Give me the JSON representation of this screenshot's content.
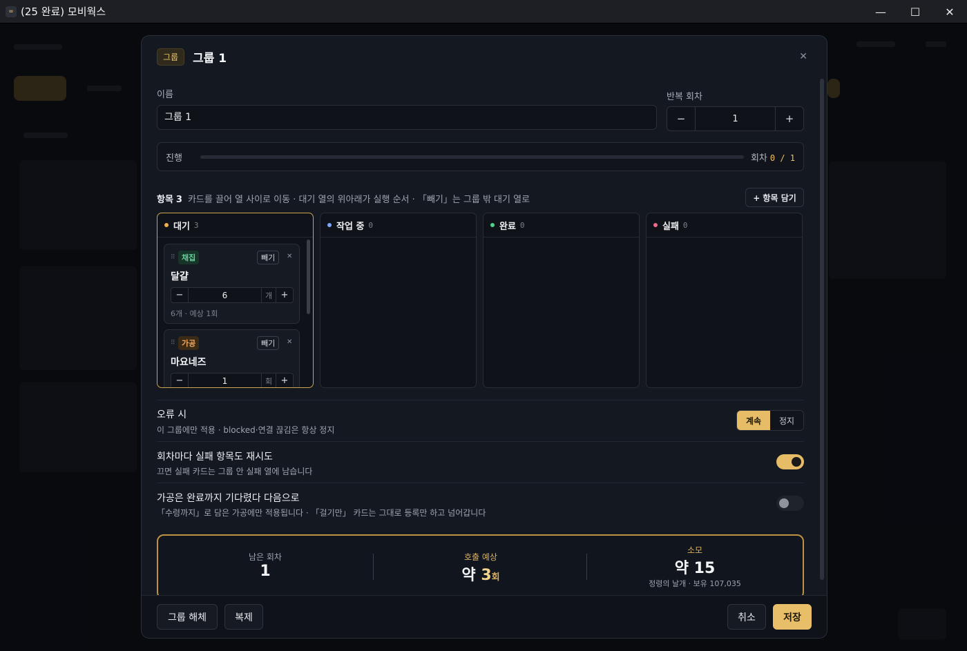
{
  "window": {
    "title": "(25 완료) 모비웍스"
  },
  "modal": {
    "chip": "그룹",
    "title": "그룹 1",
    "name_label": "이름",
    "name_value": "그룹 1",
    "repeat_label": "반복 회차",
    "repeat_value": "1",
    "progress": {
      "label": "진행",
      "round_label": "회차",
      "current": 0,
      "total": 1,
      "count_text": "0 / 1"
    },
    "items": {
      "title": "항목",
      "count": "3",
      "description": "카드를 끌어 열 사이로 이동 · 대기 열의 위아래가 실행 순서 · 「빼기」는 그룹 밖 대기 열로",
      "add_button": "+ 항목 담기"
    },
    "columns": [
      {
        "title": "대기",
        "count": "3",
        "color": "#f0b04a"
      },
      {
        "title": "작업 중",
        "count": "0",
        "color": "#7ea6ff"
      },
      {
        "title": "완료",
        "count": "0",
        "color": "#4fd38b"
      },
      {
        "title": "실패",
        "count": "0",
        "color": "#f06b8a"
      }
    ],
    "cards": [
      {
        "tag": "채집",
        "skip": "빼기",
        "name": "달걀",
        "qty": "6",
        "unit": "개",
        "meta": "6개 · 예상 1회"
      },
      {
        "tag": "가공",
        "skip": "빼기",
        "name": "마요네즈",
        "qty": "1",
        "unit": "회"
      }
    ],
    "on_error": {
      "title": "오류 시",
      "desc": "이 그룹에만 적용 · blocked·연결 끊김은 항상 정지",
      "options": [
        "계속",
        "정지"
      ],
      "selected": "계속"
    },
    "retry": {
      "title": "회차마다 실패 항목도 재시도",
      "desc": "끄면 실패 카드는 그룹 안 실패 열에 남습니다",
      "enabled": true
    },
    "wait": {
      "title": "가공은 완료까지 기다렸다 다음으로",
      "desc": "「수령까지」로 담은 가공에만 적용됩니다 · 「걸기만」 카드는 그대로 등록만 하고 넘어갑니다",
      "enabled": false
    },
    "summary": {
      "remaining_label": "남은 회차",
      "remaining_value": "1",
      "calls_label": "호출 예상",
      "calls_prefix": "약",
      "calls_value": "3",
      "calls_unit": "회",
      "cost_label": "소모",
      "cost_prefix": "약",
      "cost_value": "15",
      "cost_sub": "정령의 날개 · 보유 107,035"
    },
    "footer": {
      "ungroup": "그룹 해체",
      "duplicate": "복제",
      "cancel": "취소",
      "save": "저장"
    }
  },
  "colors": {
    "accent": "#e8be68",
    "background": "#141821"
  }
}
